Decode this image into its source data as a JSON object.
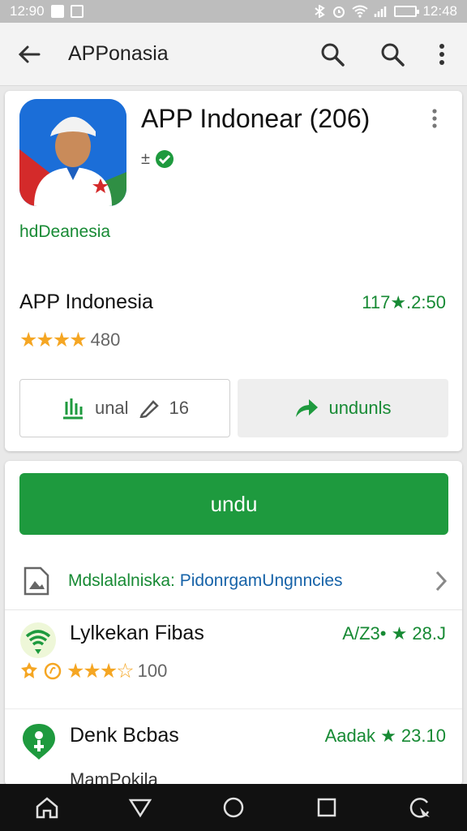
{
  "status": {
    "time_left": "12:90",
    "time_right": "12:48"
  },
  "app_bar": {
    "title": "APPonasia"
  },
  "app": {
    "title": "APP Indonear  (206)",
    "developer": "hdDeanesia",
    "name": "APP Indonesia",
    "rating_right": "117★.2:50",
    "stars": "★★★★",
    "review_count": "480",
    "btn_left_label": "unal",
    "btn_left_num": "16",
    "btn_right_label": "undunls"
  },
  "install_label": "undu",
  "info_row": {
    "part1": "Mdslalalniska:",
    "part2": "Pidonrgam",
    "part3": "Ungnncies"
  },
  "list": [
    {
      "name": "Lylkekan Fibas",
      "right": "A/Z3• ★ 28.J",
      "stars": "★★★☆",
      "count": "100"
    },
    {
      "name": "Denk Bcbas",
      "right": "Aadak ★ 23.10"
    }
  ],
  "list_partial": "MamPokila",
  "colors": {
    "accent_green": "#1e9a3e",
    "link_blue": "#1763a8",
    "star_orange": "#f5a623"
  },
  "icons": [
    "back-arrow-icon",
    "search-icon",
    "more-vert-icon",
    "home-icon",
    "back-triangle-icon",
    "circle-home-icon",
    "square-recents-icon",
    "assistant-icon"
  ]
}
